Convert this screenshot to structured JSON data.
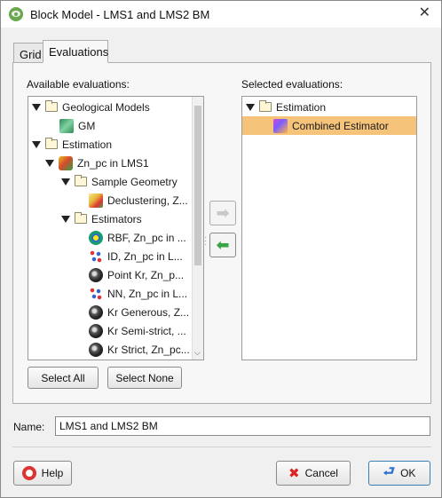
{
  "window": {
    "title": "Block Model - LMS1 and LMS2 BM",
    "close_glyph": "✕"
  },
  "tabs": [
    {
      "label": "Grid",
      "active": false
    },
    {
      "label": "Evaluations",
      "active": true
    }
  ],
  "available": {
    "label": "Available evaluations:",
    "items": [
      {
        "label": "Geological Models",
        "icon": "folder-icon"
      },
      {
        "label": "GM",
        "icon": "geological-model-icon"
      },
      {
        "label": "Estimation",
        "icon": "folder-icon"
      },
      {
        "label": "Zn_pc in LMS1",
        "icon": "domain-icon"
      },
      {
        "label": "Sample Geometry",
        "icon": "folder-icon"
      },
      {
        "label": "Declustering, Z...",
        "icon": "declustering-icon"
      },
      {
        "label": "Estimators",
        "icon": "folder-icon"
      },
      {
        "label": "RBF, Zn_pc in ...",
        "icon": "rbf-icon"
      },
      {
        "label": "ID, Zn_pc in L...",
        "icon": "id-icon"
      },
      {
        "label": "Point Kr, Zn_p...",
        "icon": "kriging-icon"
      },
      {
        "label": "NN, Zn_pc in L...",
        "icon": "nn-icon"
      },
      {
        "label": "Kr Generous, Z...",
        "icon": "kriging-icon"
      },
      {
        "label": "Kr Semi-strict, ...",
        "icon": "kriging-icon"
      },
      {
        "label": "Kr Strict, Zn_pc...",
        "icon": "kriging-icon"
      }
    ]
  },
  "selected": {
    "label": "Selected evaluations:",
    "items": [
      {
        "label": "Estimation",
        "icon": "folder-icon"
      },
      {
        "label": "Combined Estimator",
        "icon": "combined-estimator-icon",
        "selected": true
      }
    ]
  },
  "buttons": {
    "select_all": "Select All",
    "select_none": "Select None",
    "help": "Help",
    "cancel": "Cancel",
    "ok": "OK"
  },
  "name_field": {
    "label": "Name:",
    "value": "LMS1 and LMS2 BM"
  },
  "colors": {
    "selection": "#f6c37a",
    "arrow_green": "#3aa544",
    "arrow_disabled": "#c8c8c8"
  }
}
